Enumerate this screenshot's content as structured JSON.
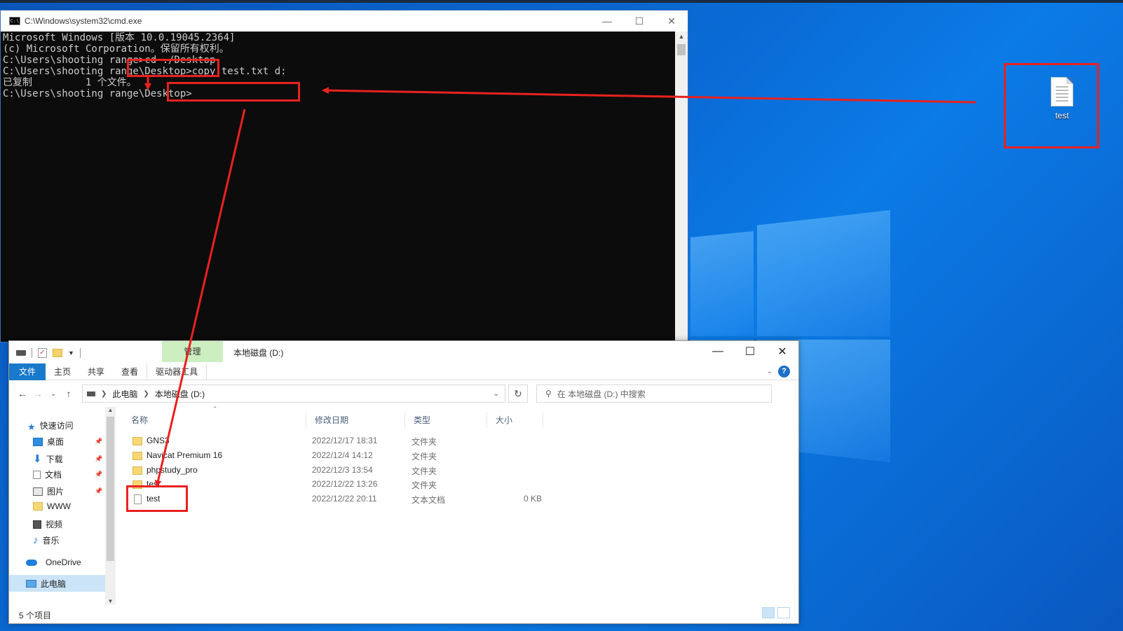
{
  "desktop": {
    "icon_label": "test"
  },
  "cmd": {
    "title": "C:\\Windows\\system32\\cmd.exe",
    "lines": [
      "Microsoft Windows [版本 10.0.19045.2364]",
      "(c) Microsoft Corporation。保留所有权利。",
      "",
      "C:\\Users\\shooting range>cd ./Desktop",
      "",
      "C:\\Users\\shooting range\\Desktop>copy test.txt d:",
      "已复制         1 个文件。",
      "",
      "C:\\Users\\shooting range\\Desktop>"
    ]
  },
  "explorer": {
    "context_tab": "管理",
    "title": "本地磁盘 (D:)",
    "ribbon_tabs": [
      "文件",
      "主页",
      "共享",
      "查看",
      "驱动器工具"
    ],
    "breadcrumb": [
      "此电脑",
      "本地磁盘 (D:)"
    ],
    "search_placeholder": "在 本地磁盘 (D:) 中搜索",
    "nav": {
      "quick_access": "快速访问",
      "items": [
        "桌面",
        "下载",
        "文档",
        "图片",
        "WWW",
        "视频",
        "音乐"
      ],
      "onedrive": "OneDrive",
      "this_pc": "此电脑"
    },
    "columns": [
      "名称",
      "修改日期",
      "类型",
      "大小"
    ],
    "files": [
      {
        "name": "GNS3",
        "date": "2022/12/17 18:31",
        "type": "文件夹",
        "size": ""
      },
      {
        "name": "Navicat Premium 16",
        "date": "2022/12/4 14:12",
        "type": "文件夹",
        "size": ""
      },
      {
        "name": "phpstudy_pro",
        "date": "2022/12/3 13:54",
        "type": "文件夹",
        "size": ""
      },
      {
        "name": "test",
        "date": "2022/12/22 13:26",
        "type": "文件夹",
        "size": ""
      },
      {
        "name": "test",
        "date": "2022/12/22 20:11",
        "type": "文本文档",
        "size": "0 KB"
      }
    ],
    "status": "5 个项目"
  },
  "colors": {
    "annotation": "#e8221f",
    "ribbon_file": "#1979ca",
    "context_tab": "#cdeec0"
  }
}
